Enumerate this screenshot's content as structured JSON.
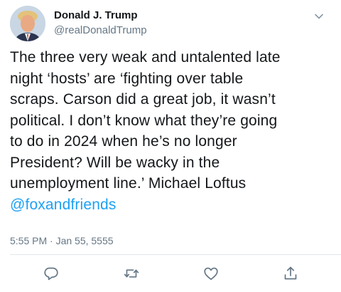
{
  "tweet": {
    "author": {
      "display_name": "Donald J. Trump",
      "handle": "@realDonaldTrump"
    },
    "text_lines": [
      "The three very weak and untalented late",
      "night ‘hosts’ are ‘fighting over table",
      "scraps. Carson did a great job, it wasn’t",
      "political. I don’t know what they’re going",
      "to do in 2024 when he’s no longer",
      "President? Will be wacky in the",
      "unemployment line.’ Michael Loftus"
    ],
    "mention": "@foxandfriends",
    "timestamp": "5:55 PM · Jan 55, 5555"
  },
  "icons": {
    "more": "chevron-down-icon",
    "reply": "reply-icon",
    "retweet": "retweet-icon",
    "like": "like-icon",
    "share": "share-icon"
  },
  "colors": {
    "link": "#1da1f2",
    "secondary_text": "#657786",
    "primary_text": "#14171a",
    "divider": "#e1e8ed"
  }
}
